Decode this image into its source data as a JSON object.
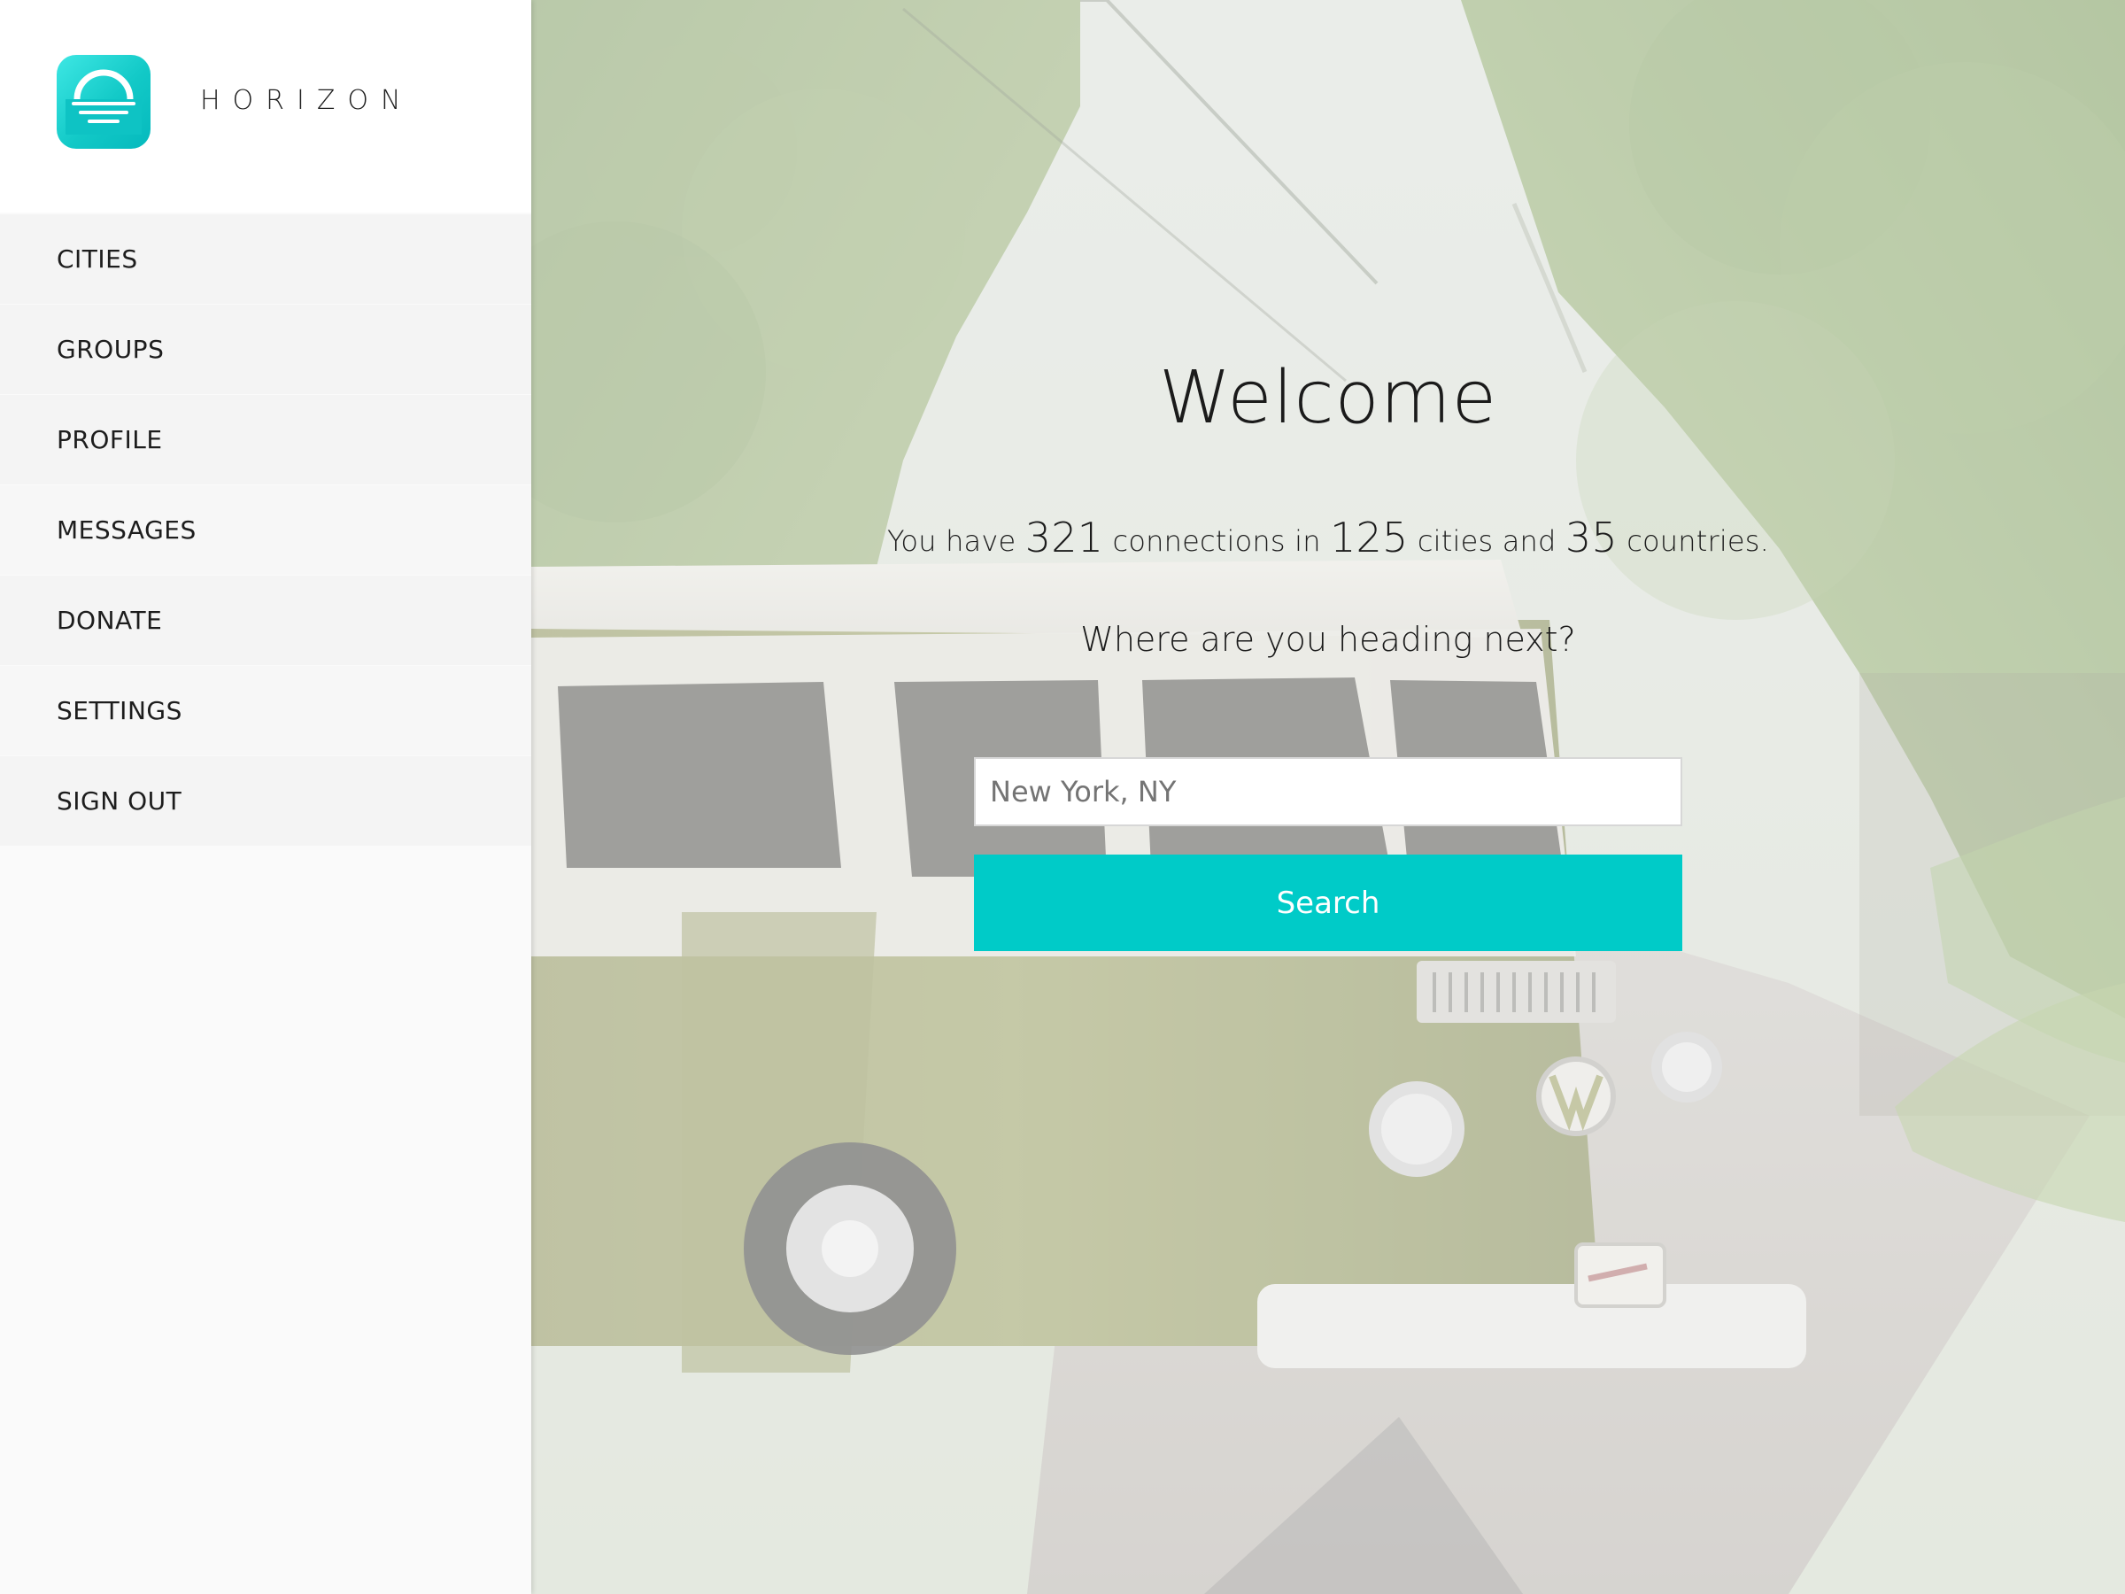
{
  "app": {
    "name": "HORIZON",
    "accent_color": "#00cbc8",
    "logo_icon": "sunrise-logo-icon"
  },
  "sidebar": {
    "items": [
      {
        "label": "CITIES"
      },
      {
        "label": "GROUPS"
      },
      {
        "label": "PROFILE"
      },
      {
        "label": "MESSAGES"
      },
      {
        "label": "DONATE"
      },
      {
        "label": "SETTINGS"
      },
      {
        "label": "SIGN OUT"
      }
    ]
  },
  "main": {
    "title": "Welcome",
    "stats": {
      "prefix": "You have",
      "connections": "321",
      "connections_label": "connections in",
      "cities": "125",
      "cities_label": "cities and",
      "countries": "35",
      "countries_label": "countries."
    },
    "subtitle": "Where are you heading next?",
    "search": {
      "placeholder": "New York, NY",
      "value": "",
      "button_label": "Search"
    }
  }
}
